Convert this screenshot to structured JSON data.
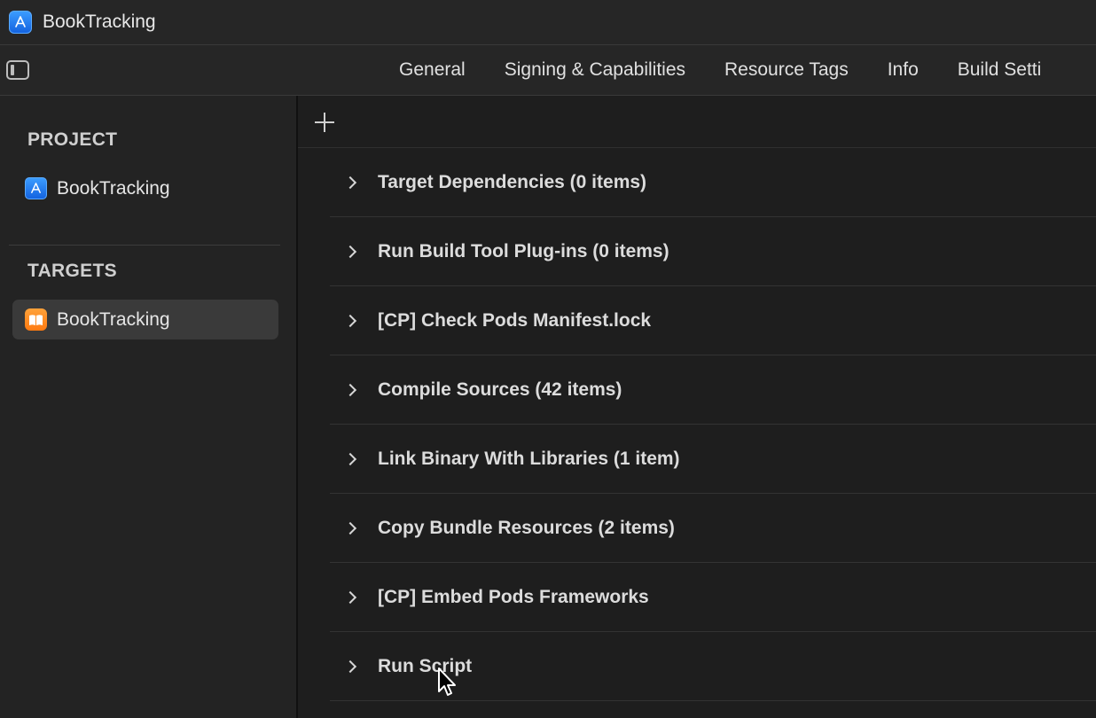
{
  "window": {
    "title": "BookTracking"
  },
  "tabs": [
    {
      "label": "General"
    },
    {
      "label": "Signing & Capabilities"
    },
    {
      "label": "Resource Tags"
    },
    {
      "label": "Info"
    },
    {
      "label": "Build Setti"
    }
  ],
  "sidebar": {
    "project_header": "PROJECT",
    "project_item": "BookTracking",
    "targets_header": "TARGETS",
    "target_item": "BookTracking"
  },
  "build_phases": [
    {
      "label": "Target Dependencies (0 items)"
    },
    {
      "label": "Run Build Tool Plug-ins (0 items)"
    },
    {
      "label": "[CP] Check Pods Manifest.lock"
    },
    {
      "label": "Compile Sources (42 items)"
    },
    {
      "label": "Link Binary With Libraries (1 item)"
    },
    {
      "label": "Copy Bundle Resources (2 items)"
    },
    {
      "label": "[CP] Embed Pods Frameworks"
    },
    {
      "label": "Run Script"
    }
  ],
  "icons": {
    "app": "xcode-project-icon",
    "target": "book-app-icon",
    "toggle": "sidebar-toggle-icon",
    "add": "plus-icon",
    "disclosure": "chevron-right-icon",
    "pointer": "mouse-cursor-icon"
  },
  "colors": {
    "project_icon": "#1463e0",
    "target_icon": "#ff7a10",
    "selected_row": "#3a3a3a"
  }
}
